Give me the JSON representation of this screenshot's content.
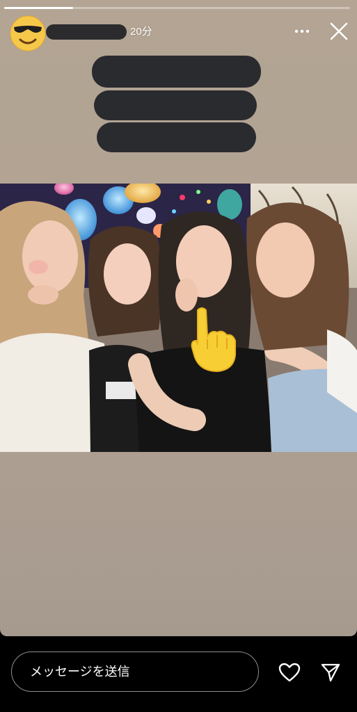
{
  "story": {
    "progress": 0.2,
    "posted_time": "20分",
    "avatar_icon": "sunglasses-emoji-icon",
    "more_icon": "more-horizontal-icon",
    "close_icon": "close-icon",
    "username_redacted": true,
    "caption_redacted_lines": 3,
    "sticker_icon": "pointing-hand-emoji-icon"
  },
  "composer": {
    "placeholder": "メッセージを送信",
    "like_icon": "heart-icon",
    "send_icon": "send-icon"
  },
  "colors": {
    "background_top": "#b3a493",
    "background_bottom": "#a69a8f",
    "redaction": "#2a2b2f",
    "bottom_bar": "#000000",
    "accent_white": "#ffffff"
  }
}
